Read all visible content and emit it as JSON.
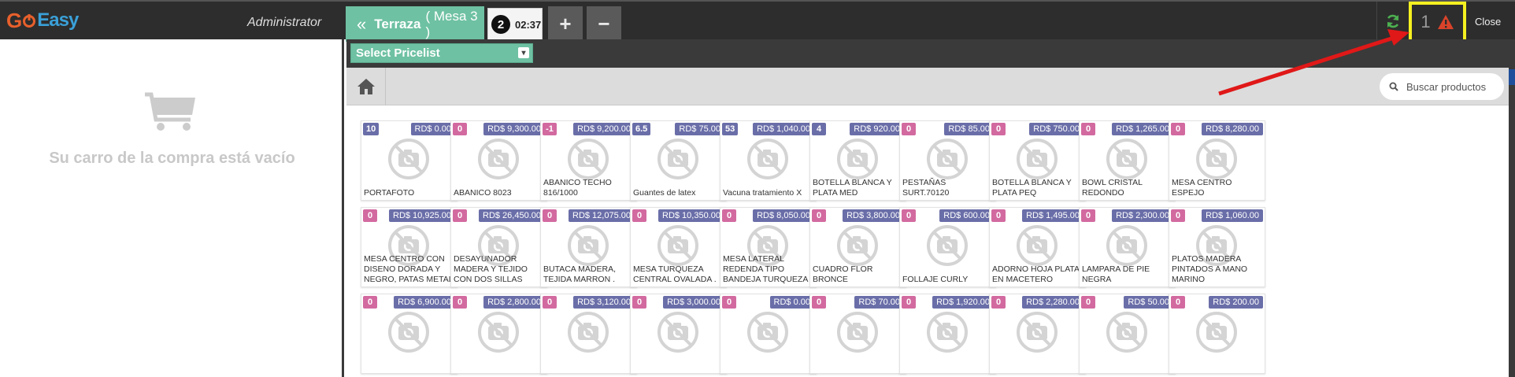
{
  "header": {
    "logo_go": "G",
    "logo_o": "o",
    "logo_easy": "Easy",
    "user": "Administrator",
    "order_tab_name": "Terraza",
    "order_tab_sub": "( Mesa 3 )",
    "timer_count": "2",
    "timer_time": "02:37",
    "add_order_label": "+",
    "remove_order_label": "−",
    "alert_count": "1",
    "close_label": "Close"
  },
  "cart": {
    "empty_text": "Su carro de la compra está vacío"
  },
  "pricelist": {
    "selected": "Select Pricelist"
  },
  "search": {
    "placeholder": "Buscar productos"
  },
  "colors": {
    "topbar": "#2d2d2d",
    "accent_green": "#6ec1a3",
    "badge_blue": "#6a6ea8",
    "badge_pink": "#d26aa0",
    "alert_highlight": "#f5f020",
    "annotation_red": "#e01818"
  },
  "icons": {
    "back": "double-chevron-left-icon",
    "sync": "refresh-icon",
    "alert": "warning-triangle-icon",
    "home": "home-icon",
    "search": "search-icon",
    "cart": "shopping-cart-icon",
    "no_image": "no-photo-icon"
  },
  "products": [
    [
      {
        "qty": "10",
        "price": "RD$ 0.00",
        "name": "PORTAFOTO"
      },
      {
        "qty": "0",
        "price": "RD$ 9,300.00",
        "name": "ABANICO 8023"
      },
      {
        "qty": "-1",
        "price": "RD$ 9,200.00",
        "name": "ABANICO TECHO 816/1000"
      },
      {
        "qty": "6.5",
        "price": "RD$ 75.00",
        "name": "Guantes de latex"
      },
      {
        "qty": "53",
        "price": "RD$ 1,040.00",
        "name": "Vacuna tratamiento X"
      },
      {
        "qty": "4",
        "price": "RD$ 920.00",
        "name": "BOTELLA BLANCA Y PLATA MED"
      },
      {
        "qty": "0",
        "price": "RD$ 85.00",
        "name": "PESTAÑAS SURT.70120"
      },
      {
        "qty": "0",
        "price": "RD$ 750.00",
        "name": "BOTELLA BLANCA Y PLATA PEQ"
      },
      {
        "qty": "0",
        "price": "RD$ 1,265.00",
        "name": "BOWL CRISTAL REDONDO"
      },
      {
        "qty": "0",
        "price": "RD$ 8,280.00",
        "name": "MESA CENTRO ESPEJO"
      }
    ],
    [
      {
        "qty": "0",
        "price": "RD$ 10,925.00",
        "name": "MESA CENTRO CON DISENO DORADA Y NEGRO, PATAS METAL"
      },
      {
        "qty": "0",
        "price": "RD$ 26,450.00",
        "name": "DESAYUNADOR MADERA Y TEJIDO CON DOS SILLAS"
      },
      {
        "qty": "0",
        "price": "RD$ 12,075.00",
        "name": "BUTACA MADERA, TEJIDA MARRON ."
      },
      {
        "qty": "0",
        "price": "RD$ 10,350.00",
        "name": "MESA TURQUEZA CENTRAL OVALADA ."
      },
      {
        "qty": "0",
        "price": "RD$ 8,050.00",
        "name": "MESA LATERAL REDENDA TIPO BANDEJA TURQUEZA"
      },
      {
        "qty": "0",
        "price": "RD$ 3,800.00",
        "name": "CUADRO FLOR BRONCE"
      },
      {
        "qty": "0",
        "price": "RD$ 600.00",
        "name": "FOLLAJE CURLY"
      },
      {
        "qty": "0",
        "price": "RD$ 1,495.00",
        "name": "ADORNO HOJA PLATA EN MACETERO"
      },
      {
        "qty": "0",
        "price": "RD$ 2,300.00",
        "name": "LAMPARA DE PIE NEGRA"
      },
      {
        "qty": "0",
        "price": "RD$ 1,060.00",
        "name": "PLATOS MADERA PINTADOS A MANO MARINO"
      }
    ],
    [
      {
        "qty": "0",
        "price": "RD$ 6,900.00",
        "name": ""
      },
      {
        "qty": "0",
        "price": "RD$ 2,800.00",
        "name": ""
      },
      {
        "qty": "0",
        "price": "RD$ 3,120.00",
        "name": ""
      },
      {
        "qty": "0",
        "price": "RD$ 3,000.00",
        "name": ""
      },
      {
        "qty": "0",
        "price": "RD$ 0.00",
        "name": ""
      },
      {
        "qty": "0",
        "price": "RD$ 70.00",
        "name": ""
      },
      {
        "qty": "0",
        "price": "RD$ 1,920.00",
        "name": ""
      },
      {
        "qty": "0",
        "price": "RD$ 2,280.00",
        "name": ""
      },
      {
        "qty": "0",
        "price": "RD$ 50.00",
        "name": ""
      },
      {
        "qty": "0",
        "price": "RD$ 200.00",
        "name": ""
      }
    ]
  ]
}
